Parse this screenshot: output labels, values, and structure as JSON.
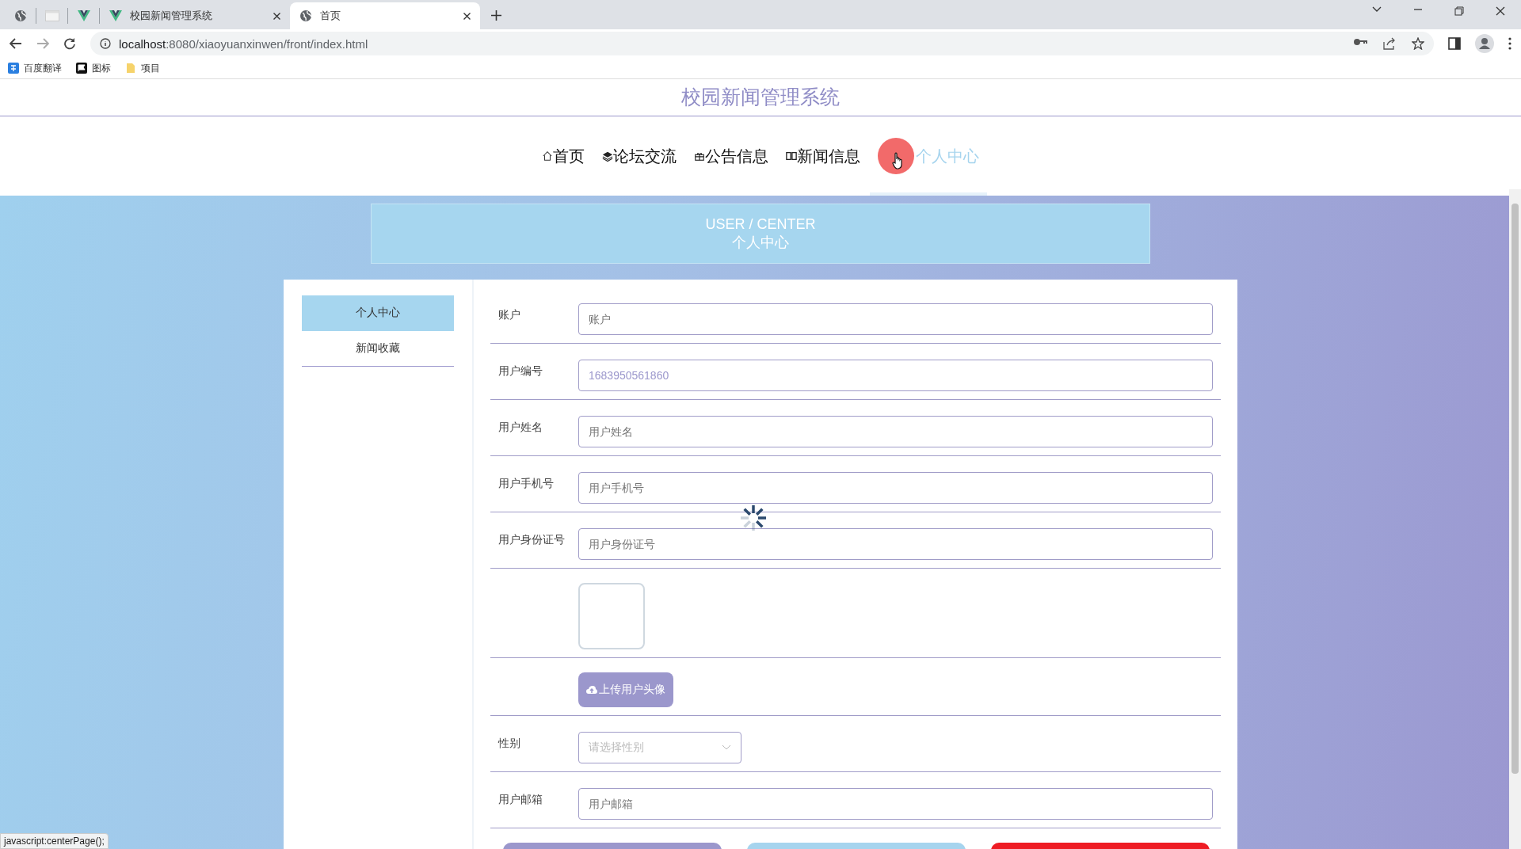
{
  "browser": {
    "tabs": [
      {
        "kind": "pinned",
        "selected": false
      },
      {
        "kind": "pinned",
        "selected": false
      },
      {
        "kind": "pinned",
        "selected": false
      },
      {
        "kind": "full",
        "title": "校园新闻管理系统",
        "selected": false
      },
      {
        "kind": "full",
        "title": "首页",
        "selected": true
      }
    ],
    "address": {
      "host": "localhost",
      "path": ":8080/xiaoyuanxinwen/front/index.html"
    },
    "bookmarks": [
      "百度翻译",
      "图标",
      "项目"
    ]
  },
  "site_title": "校园新闻管理系统",
  "nav": [
    {
      "label": "首页",
      "selected": false
    },
    {
      "label": "论坛交流",
      "selected": false
    },
    {
      "label": "公告信息",
      "selected": false
    },
    {
      "label": "新闻信息",
      "selected": false
    },
    {
      "label": "个人中心",
      "selected": true
    }
  ],
  "banner": {
    "title": "USER / CENTER",
    "subtitle": "个人中心"
  },
  "sidebar": [
    {
      "label": "个人中心",
      "selected": true
    },
    {
      "label": "新闻收藏",
      "selected": false
    }
  ],
  "form": [
    {
      "kind": "text",
      "label": "账户",
      "placeholder": "账户"
    },
    {
      "kind": "text",
      "label": "用户编号",
      "value": "1683950561860",
      "disabled": true
    },
    {
      "kind": "text",
      "label": "用户姓名",
      "placeholder": "用户姓名"
    },
    {
      "kind": "text",
      "label": "用户手机号",
      "placeholder": "用户手机号"
    },
    {
      "kind": "text",
      "label": "用户身份证号",
      "placeholder": "用户身份证号"
    },
    {
      "kind": "image"
    },
    {
      "kind": "upload",
      "button": "上传用户头像"
    },
    {
      "kind": "select",
      "label": "性别",
      "placeholder": "请选择性别"
    },
    {
      "kind": "text",
      "label": "用户邮箱",
      "placeholder": "用户邮箱"
    }
  ],
  "actions": [
    {
      "color": "#9b97cc"
    },
    {
      "color": "#a6d4ee"
    },
    {
      "color": "#ee1c24"
    }
  ],
  "status_bar": "javascript:centerPage();"
}
